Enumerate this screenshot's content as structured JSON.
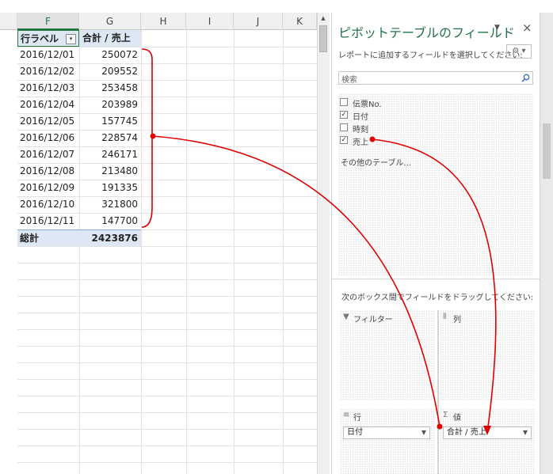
{
  "sheet": {
    "columns": [
      "F",
      "G",
      "H",
      "I",
      "J",
      "K"
    ],
    "selected_column": "F",
    "header_row_label": "行ラベル",
    "header_value_label": "合計 / 売上",
    "rows": [
      {
        "date": "2016/12/01",
        "value": "250072"
      },
      {
        "date": "2016/12/02",
        "value": "209552"
      },
      {
        "date": "2016/12/03",
        "value": "253458"
      },
      {
        "date": "2016/12/04",
        "value": "203989"
      },
      {
        "date": "2016/12/05",
        "value": "157745"
      },
      {
        "date": "2016/12/06",
        "value": "228574"
      },
      {
        "date": "2016/12/07",
        "value": "246171"
      },
      {
        "date": "2016/12/08",
        "value": "213480"
      },
      {
        "date": "2016/12/09",
        "value": "191335"
      },
      {
        "date": "2016/12/10",
        "value": "321800"
      },
      {
        "date": "2016/12/11",
        "value": "147700"
      }
    ],
    "total_label": "総計",
    "total_value": "2423876"
  },
  "pane": {
    "title": "ピボットテーブルのフィールド",
    "close_glyph": "×",
    "pin_glyph": "▼",
    "instruction": "レポートに追加するフィールドを選択してください:",
    "settings_glyph": "⚙ ▾",
    "search_placeholder": "検索",
    "fields": [
      {
        "label": "伝票No.",
        "checked": false
      },
      {
        "label": "日付",
        "checked": true
      },
      {
        "label": "時刻",
        "checked": false
      },
      {
        "label": "売上",
        "checked": true
      }
    ],
    "more_tables": "その他のテーブル...",
    "drag_hint": "次のボックス間でフィールドをドラッグしてください:",
    "areas": {
      "filter": "フィルター",
      "column": "列",
      "row": "行",
      "values": "値"
    },
    "row_field": "日付",
    "value_field": "合計 / 売上"
  },
  "annotation": {
    "color": "#e00000"
  }
}
